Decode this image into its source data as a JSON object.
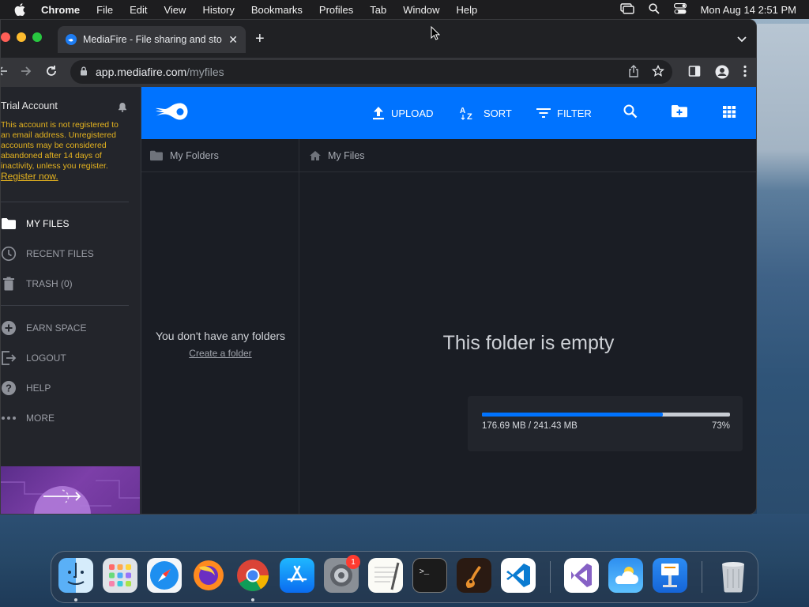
{
  "menubar": {
    "app_name": "Chrome",
    "items": [
      "File",
      "Edit",
      "View",
      "History",
      "Bookmarks",
      "Profiles",
      "Tab",
      "Window",
      "Help"
    ],
    "clock": "Mon Aug 14  2:51 PM"
  },
  "browser": {
    "tab_title": "MediaFire - File sharing and sto",
    "url_host": "app.mediafire.com",
    "url_path": "/myfiles"
  },
  "sidebar": {
    "account_title": "Trial Account",
    "trial_message": "This account is not registered to an email address. Unregistered accounts may be considered abandoned after 14 days of inactivity, unless you register.",
    "register_link": "Register now.",
    "nav": {
      "my_files": "MY FILES",
      "recent_files": "RECENT FILES",
      "trash": "TRASH (0)",
      "earn_space": "EARN SPACE",
      "logout": "LOGOUT",
      "help": "HELP",
      "more": "MORE"
    }
  },
  "topbar": {
    "upload": "UPLOAD",
    "sort": "SORT",
    "filter": "FILTER",
    "brand_color": "#0073ff"
  },
  "folders_pane": {
    "header": "My Folders",
    "empty_text": "You don't have any folders",
    "create_link": "Create a folder"
  },
  "files_pane": {
    "header": "My Files",
    "empty_text": "This folder is empty"
  },
  "storage": {
    "used_label": "176.69 MB / 241.43 MB",
    "percent_label": "73%",
    "fraction": 0.73
  },
  "dock": {
    "apps": [
      "finder",
      "launchpad",
      "safari",
      "firefox",
      "chrome",
      "app-store",
      "system-settings",
      "textedit",
      "terminal",
      "garageband",
      "vscode",
      "visual-studio",
      "weather",
      "keynote",
      "trash"
    ],
    "settings_badge": "1"
  }
}
